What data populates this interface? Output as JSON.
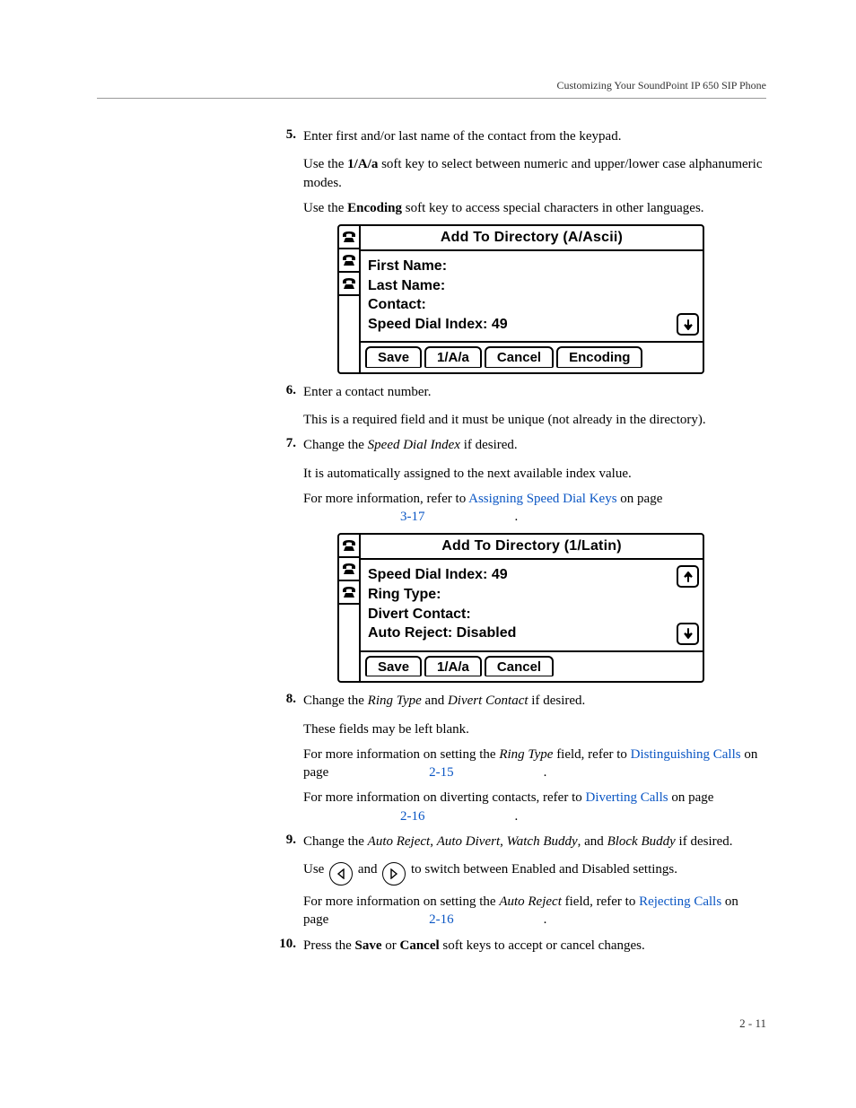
{
  "header": {
    "title": "Customizing Your SoundPoint IP 650 SIP Phone"
  },
  "steps": {
    "s5": {
      "num": "5.",
      "main": "Enter first and/or last name of the contact from the keypad.",
      "p2_a": "Use the ",
      "p2_key": "1/A/a",
      "p2_b": " soft key to select between numeric and upper/lower case alphanumeric modes.",
      "p3_a": "Use the ",
      "p3_key": "Encoding",
      "p3_b": " soft key to access special characters in other languages."
    },
    "s6": {
      "num": "6.",
      "main": "Enter a contact number.",
      "p2": "This is a required field and it must be unique (not already in the directory)."
    },
    "s7": {
      "num": "7.",
      "main_a": "Change the ",
      "main_i": "Speed Dial Index",
      "main_b": " if desired.",
      "p2": "It is automatically assigned to the next available index value.",
      "p3_a": "For more information, refer to ",
      "p3_link": "Assigning Speed Dial Keys",
      "p3_b": " on page ",
      "p3_page": "3-17",
      "p3_c": "."
    },
    "s8": {
      "num": "8.",
      "main_a": "Change the ",
      "main_i1": "Ring Type",
      "main_mid": " and ",
      "main_i2": "Divert Contact",
      "main_b": " if desired.",
      "p2": "These fields may be left blank.",
      "p3_a": "For more information on setting the ",
      "p3_i": "Ring Type",
      "p3_b": " field, refer to ",
      "p3_link": "Distinguishing Calls",
      "p3_c": " on page ",
      "p3_page": "2-15",
      "p3_d": ".",
      "p4_a": "For more information on diverting contacts, refer to ",
      "p4_link": "Diverting Calls",
      "p4_b": " on page ",
      "p4_page": "2-16",
      "p4_c": "."
    },
    "s9": {
      "num": "9.",
      "main_a": "Change the ",
      "i1": "Auto Reject",
      "c1": ", ",
      "i2": "Auto Divert",
      "c2": ", ",
      "i3": "Watch Buddy",
      "c3": ", and ",
      "i4": "Block Buddy",
      "main_b": " if desired.",
      "p2_a": "Use ",
      "p2_mid": " and ",
      "p2_b": "  to switch between Enabled and Disabled settings.",
      "p3_a": "For more information on setting the ",
      "p3_i": "Auto Reject",
      "p3_b": " field, refer to ",
      "p3_link": "Rejecting Calls",
      "p3_c": " on page ",
      "p3_page": "2-16",
      "p3_d": "."
    },
    "s10": {
      "num": "10.",
      "main_a": "Press the ",
      "k1": "Save",
      "mid": " or ",
      "k2": "Cancel",
      "main_b": " soft keys to accept or cancel changes."
    }
  },
  "lcd1": {
    "title": "Add To Directory (A/Ascii)",
    "line1": "First Name:",
    "line2": "Last Name:",
    "line3": "Contact:",
    "line4": "Speed Dial Index: 49",
    "sk1": "Save",
    "sk2": "1/A/a",
    "sk3": "Cancel",
    "sk4": "Encoding"
  },
  "lcd2": {
    "title": "Add To Directory (1/Latin)",
    "line1": "Speed Dial Index: 49",
    "line2": "Ring Type:",
    "line3": "Divert Contact:",
    "line4": "Auto Reject: Disabled",
    "sk1": "Save",
    "sk2": "1/A/a",
    "sk3": "Cancel"
  },
  "footer": {
    "page_num": "2 - 11"
  }
}
